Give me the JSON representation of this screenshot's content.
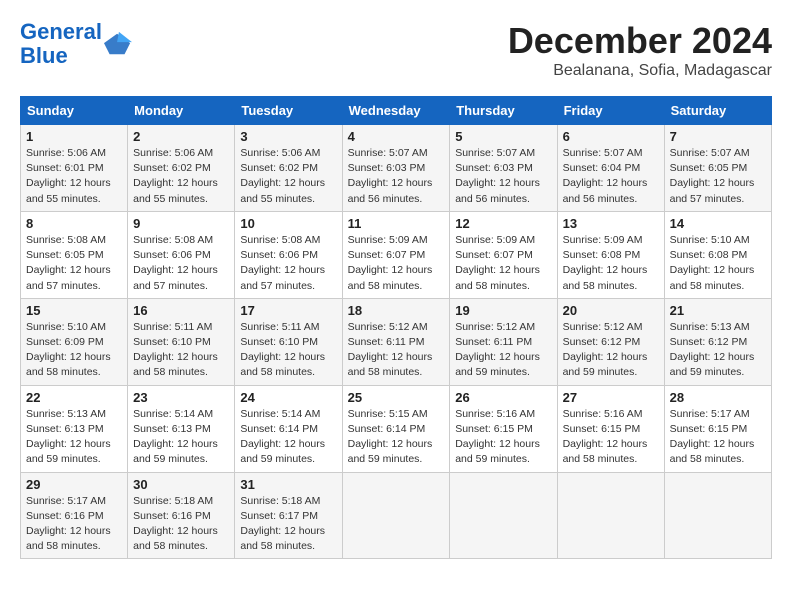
{
  "header": {
    "logo_line1": "General",
    "logo_line2": "Blue",
    "month": "December 2024",
    "location": "Bealanana, Sofia, Madagascar"
  },
  "weekdays": [
    "Sunday",
    "Monday",
    "Tuesday",
    "Wednesday",
    "Thursday",
    "Friday",
    "Saturday"
  ],
  "weeks": [
    [
      {
        "day": "1",
        "sunrise": "Sunrise: 5:06 AM",
        "sunset": "Sunset: 6:01 PM",
        "daylight": "Daylight: 12 hours and 55 minutes."
      },
      {
        "day": "2",
        "sunrise": "Sunrise: 5:06 AM",
        "sunset": "Sunset: 6:02 PM",
        "daylight": "Daylight: 12 hours and 55 minutes."
      },
      {
        "day": "3",
        "sunrise": "Sunrise: 5:06 AM",
        "sunset": "Sunset: 6:02 PM",
        "daylight": "Daylight: 12 hours and 55 minutes."
      },
      {
        "day": "4",
        "sunrise": "Sunrise: 5:07 AM",
        "sunset": "Sunset: 6:03 PM",
        "daylight": "Daylight: 12 hours and 56 minutes."
      },
      {
        "day": "5",
        "sunrise": "Sunrise: 5:07 AM",
        "sunset": "Sunset: 6:03 PM",
        "daylight": "Daylight: 12 hours and 56 minutes."
      },
      {
        "day": "6",
        "sunrise": "Sunrise: 5:07 AM",
        "sunset": "Sunset: 6:04 PM",
        "daylight": "Daylight: 12 hours and 56 minutes."
      },
      {
        "day": "7",
        "sunrise": "Sunrise: 5:07 AM",
        "sunset": "Sunset: 6:05 PM",
        "daylight": "Daylight: 12 hours and 57 minutes."
      }
    ],
    [
      {
        "day": "8",
        "sunrise": "Sunrise: 5:08 AM",
        "sunset": "Sunset: 6:05 PM",
        "daylight": "Daylight: 12 hours and 57 minutes."
      },
      {
        "day": "9",
        "sunrise": "Sunrise: 5:08 AM",
        "sunset": "Sunset: 6:06 PM",
        "daylight": "Daylight: 12 hours and 57 minutes."
      },
      {
        "day": "10",
        "sunrise": "Sunrise: 5:08 AM",
        "sunset": "Sunset: 6:06 PM",
        "daylight": "Daylight: 12 hours and 57 minutes."
      },
      {
        "day": "11",
        "sunrise": "Sunrise: 5:09 AM",
        "sunset": "Sunset: 6:07 PM",
        "daylight": "Daylight: 12 hours and 58 minutes."
      },
      {
        "day": "12",
        "sunrise": "Sunrise: 5:09 AM",
        "sunset": "Sunset: 6:07 PM",
        "daylight": "Daylight: 12 hours and 58 minutes."
      },
      {
        "day": "13",
        "sunrise": "Sunrise: 5:09 AM",
        "sunset": "Sunset: 6:08 PM",
        "daylight": "Daylight: 12 hours and 58 minutes."
      },
      {
        "day": "14",
        "sunrise": "Sunrise: 5:10 AM",
        "sunset": "Sunset: 6:08 PM",
        "daylight": "Daylight: 12 hours and 58 minutes."
      }
    ],
    [
      {
        "day": "15",
        "sunrise": "Sunrise: 5:10 AM",
        "sunset": "Sunset: 6:09 PM",
        "daylight": "Daylight: 12 hours and 58 minutes."
      },
      {
        "day": "16",
        "sunrise": "Sunrise: 5:11 AM",
        "sunset": "Sunset: 6:10 PM",
        "daylight": "Daylight: 12 hours and 58 minutes."
      },
      {
        "day": "17",
        "sunrise": "Sunrise: 5:11 AM",
        "sunset": "Sunset: 6:10 PM",
        "daylight": "Daylight: 12 hours and 58 minutes."
      },
      {
        "day": "18",
        "sunrise": "Sunrise: 5:12 AM",
        "sunset": "Sunset: 6:11 PM",
        "daylight": "Daylight: 12 hours and 58 minutes."
      },
      {
        "day": "19",
        "sunrise": "Sunrise: 5:12 AM",
        "sunset": "Sunset: 6:11 PM",
        "daylight": "Daylight: 12 hours and 59 minutes."
      },
      {
        "day": "20",
        "sunrise": "Sunrise: 5:12 AM",
        "sunset": "Sunset: 6:12 PM",
        "daylight": "Daylight: 12 hours and 59 minutes."
      },
      {
        "day": "21",
        "sunrise": "Sunrise: 5:13 AM",
        "sunset": "Sunset: 6:12 PM",
        "daylight": "Daylight: 12 hours and 59 minutes."
      }
    ],
    [
      {
        "day": "22",
        "sunrise": "Sunrise: 5:13 AM",
        "sunset": "Sunset: 6:13 PM",
        "daylight": "Daylight: 12 hours and 59 minutes."
      },
      {
        "day": "23",
        "sunrise": "Sunrise: 5:14 AM",
        "sunset": "Sunset: 6:13 PM",
        "daylight": "Daylight: 12 hours and 59 minutes."
      },
      {
        "day": "24",
        "sunrise": "Sunrise: 5:14 AM",
        "sunset": "Sunset: 6:14 PM",
        "daylight": "Daylight: 12 hours and 59 minutes."
      },
      {
        "day": "25",
        "sunrise": "Sunrise: 5:15 AM",
        "sunset": "Sunset: 6:14 PM",
        "daylight": "Daylight: 12 hours and 59 minutes."
      },
      {
        "day": "26",
        "sunrise": "Sunrise: 5:16 AM",
        "sunset": "Sunset: 6:15 PM",
        "daylight": "Daylight: 12 hours and 59 minutes."
      },
      {
        "day": "27",
        "sunrise": "Sunrise: 5:16 AM",
        "sunset": "Sunset: 6:15 PM",
        "daylight": "Daylight: 12 hours and 58 minutes."
      },
      {
        "day": "28",
        "sunrise": "Sunrise: 5:17 AM",
        "sunset": "Sunset: 6:15 PM",
        "daylight": "Daylight: 12 hours and 58 minutes."
      }
    ],
    [
      {
        "day": "29",
        "sunrise": "Sunrise: 5:17 AM",
        "sunset": "Sunset: 6:16 PM",
        "daylight": "Daylight: 12 hours and 58 minutes."
      },
      {
        "day": "30",
        "sunrise": "Sunrise: 5:18 AM",
        "sunset": "Sunset: 6:16 PM",
        "daylight": "Daylight: 12 hours and 58 minutes."
      },
      {
        "day": "31",
        "sunrise": "Sunrise: 5:18 AM",
        "sunset": "Sunset: 6:17 PM",
        "daylight": "Daylight: 12 hours and 58 minutes."
      },
      null,
      null,
      null,
      null
    ]
  ]
}
